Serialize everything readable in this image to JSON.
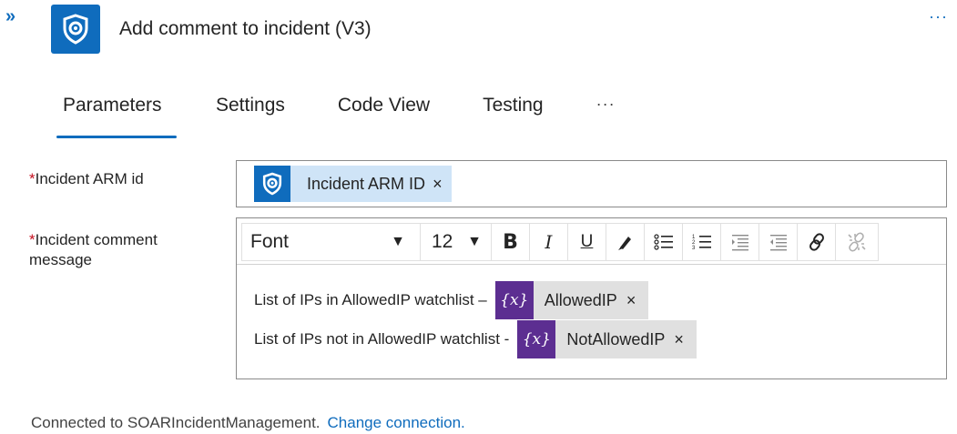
{
  "header": {
    "collapse_glyph": "»",
    "title": "Add comment to incident (V3)",
    "more_glyph": "···",
    "icon": "sentinel-shield-icon",
    "brand_color": "#0f6cbd"
  },
  "tabs": [
    {
      "label": "Parameters",
      "active": true
    },
    {
      "label": "Settings",
      "active": false
    },
    {
      "label": "Code View",
      "active": false
    },
    {
      "label": "Testing",
      "active": false
    }
  ],
  "tabs_more_glyph": "···",
  "fields": {
    "required_marker": "*",
    "arm_id": {
      "label": "Incident ARM id",
      "token": {
        "label": "Incident ARM ID",
        "remove": "×",
        "icon": "sentinel-shield-icon"
      }
    },
    "comment": {
      "label_line1": "Incident comment",
      "label_line2": "message",
      "toolbar": {
        "font_value": "Font",
        "size_value": "12",
        "bold": "B",
        "italic": "I",
        "underline": "U",
        "icons": [
          "font-color-icon",
          "bullet-list-icon",
          "numbered-list-icon",
          "decrease-indent-icon",
          "increase-indent-icon",
          "link-icon",
          "unlink-icon"
        ]
      },
      "lines": [
        {
          "text": "List of IPs in AllowedIP watchlist –",
          "token": {
            "icon": "{x}",
            "label": "AllowedIP",
            "remove": "×"
          }
        },
        {
          "text": "List of IPs not in AllowedIP watchlist -",
          "token": {
            "icon": "{x}",
            "label": "NotAllowedIP",
            "remove": "×"
          }
        }
      ],
      "variable_token_color": "#5c2e91"
    }
  },
  "footer": {
    "text": "Connected to SOARIncidentManagement.",
    "link": "Change connection."
  }
}
